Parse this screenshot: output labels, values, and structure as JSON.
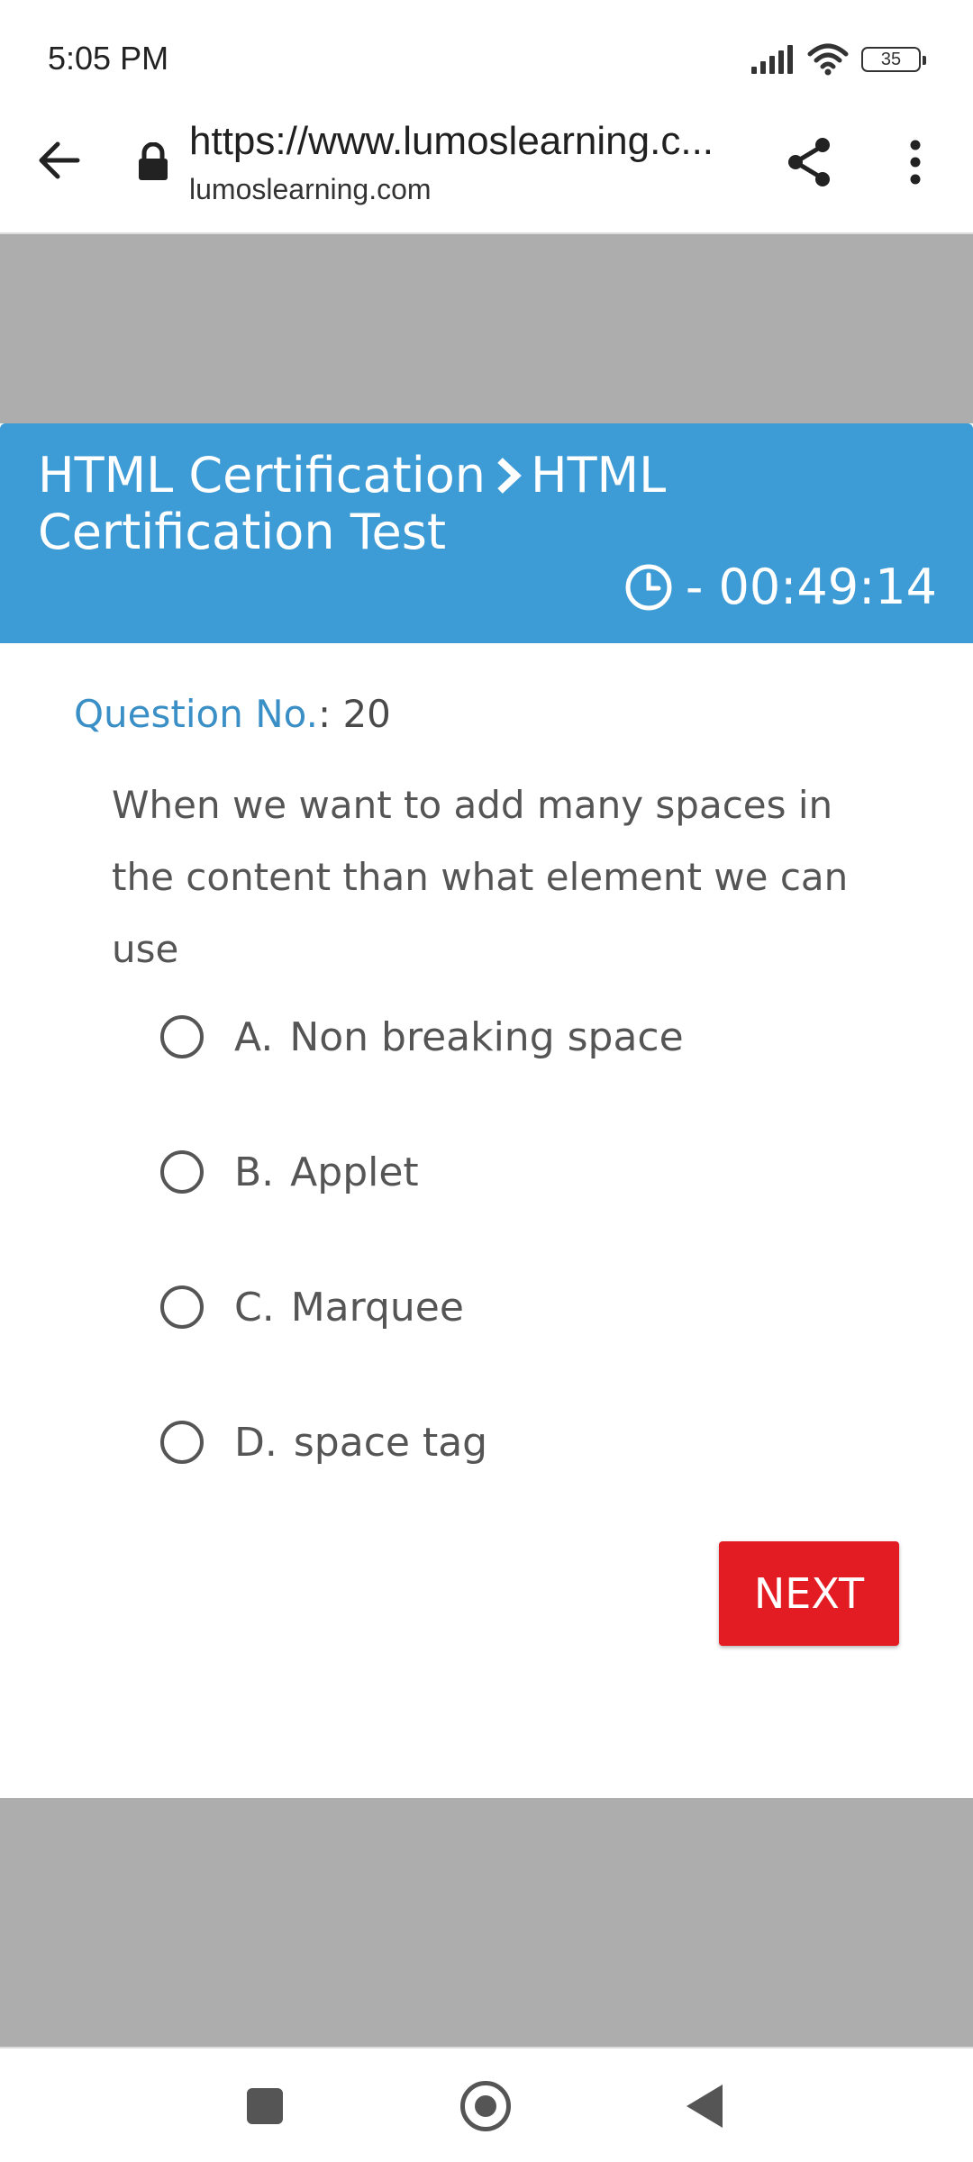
{
  "status_bar": {
    "time": "5:05 PM",
    "battery": "35",
    "icons": [
      "signal-icon",
      "wifi-icon",
      "battery-icon"
    ]
  },
  "browser": {
    "url": "https://www.lumoslearning.c...",
    "domain": "lumoslearning.com",
    "icons": [
      "back-arrow-icon",
      "lock-icon",
      "share-icon",
      "more-vert-icon"
    ]
  },
  "header": {
    "crumb_parent": "HTML Certification",
    "crumb_current": "HTML Certification Test",
    "timer": "- 00:49:14",
    "timer_icon": "clock-icon"
  },
  "question": {
    "number_label": "Question No.",
    "number": ": 20",
    "text": "When we want to add many spaces in the content than what element we can use"
  },
  "options": [
    {
      "letter": "A.",
      "text": "Non breaking space"
    },
    {
      "letter": "B.",
      "text": "Applet"
    },
    {
      "letter": "C.",
      "text": "Marquee"
    },
    {
      "letter": "D.",
      "text": "space tag"
    }
  ],
  "next_button": "NEXT",
  "colors": {
    "header_bg": "#3d9bd6",
    "next_bg": "#e31b23",
    "page_gray": "#adadad"
  },
  "nav_bar": {
    "icons": [
      "recents-square-icon",
      "home-circle-icon",
      "back-triangle-icon"
    ]
  }
}
